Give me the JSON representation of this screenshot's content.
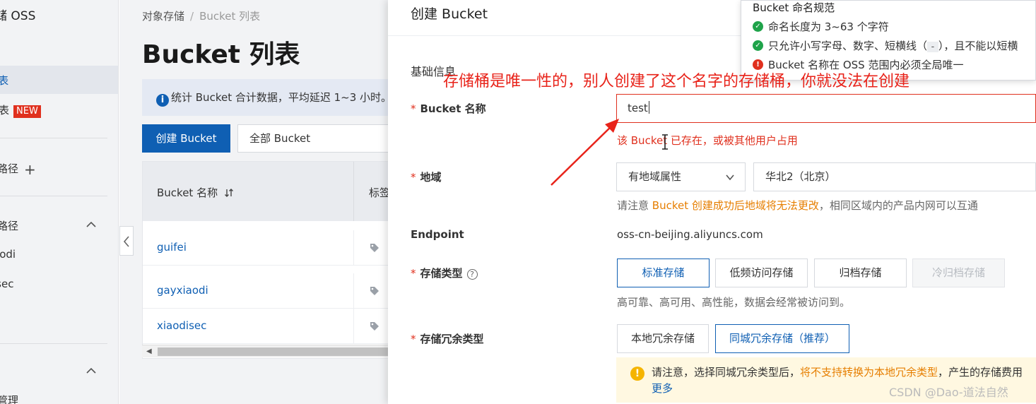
{
  "sidebar": {
    "title": "对象存储 OSS",
    "active_item": "Bucket 列表",
    "item_new": "表",
    "new_badge": "NEW",
    "path1": "路径",
    "path2": "路径",
    "sub1": "aodi",
    "sub2": "isec",
    "bottom": "管理"
  },
  "main": {
    "breadcrumb": [
      "对象存储",
      "Bucket 列表"
    ],
    "title": "Bucket 列表",
    "info": "统计 Bucket 合计数据，平均延迟 1~3 小时。",
    "create_button": "创建 Bucket",
    "filter_button": "全部 Bucket",
    "table": {
      "col_name": "Bucket 名称",
      "col_tag": "标签",
      "rows": [
        {
          "name": "guifei"
        },
        {
          "name": "gayxiaodi"
        },
        {
          "name": "xiaodisec"
        }
      ]
    }
  },
  "drawer": {
    "title": "创建 Bucket",
    "section": "基础信息",
    "name_label": "Bucket 名称",
    "name_value": "test",
    "name_error": "该 Bucket 已存在，或被其他用户占用",
    "region_label": "地域",
    "region_type": "有地域属性",
    "region_value": "华北2（北京）",
    "region_note_pre": "请注意 ",
    "region_note_warn": "Bucket 创建成功后地域将无法更改",
    "region_note_post": "，相同区域内的产品内网可以互通",
    "endpoint_label": "Endpoint",
    "endpoint_value": "oss-cn-beijing.aliyuncs.com",
    "storage_label": "存储类型",
    "storage_help": "?",
    "storage_options": [
      "标准存储",
      "低频访问存储",
      "归档存储",
      "冷归档存储"
    ],
    "storage_desc": "高可靠、高可用、高性能，数据会经常被访问到。",
    "redundancy_label": "存储冗余类型",
    "redundancy_options": [
      "本地冗余存储",
      "同城冗余存储（推荐）"
    ],
    "notice_pre": "请注意，选择同城冗余类型后，",
    "notice_warn": "将不支持转换为本地冗余类型",
    "notice_post": "，产生的存储费用",
    "notice_more": "更多"
  },
  "tooltip": {
    "title": "Bucket 命名规范",
    "rule1": "命名长度为 3~63 个字符",
    "rule2_pre": "只允许小写字母、数字、短横线（",
    "rule2_code": "-",
    "rule2_post": "），且不能以短横",
    "rule3": "Bucket 名称在 OSS 范围内必须全局唯一"
  },
  "annotation": "存储桶是唯一性的，别人创建了这个名字的存储桶，你就没法在创建",
  "watermark": "CSDN @Dao-道法自然",
  "colors": {
    "primary": "#0f5fb3",
    "error": "#e0301e",
    "warning": "#e67e00",
    "annotation": "#e8231a"
  }
}
